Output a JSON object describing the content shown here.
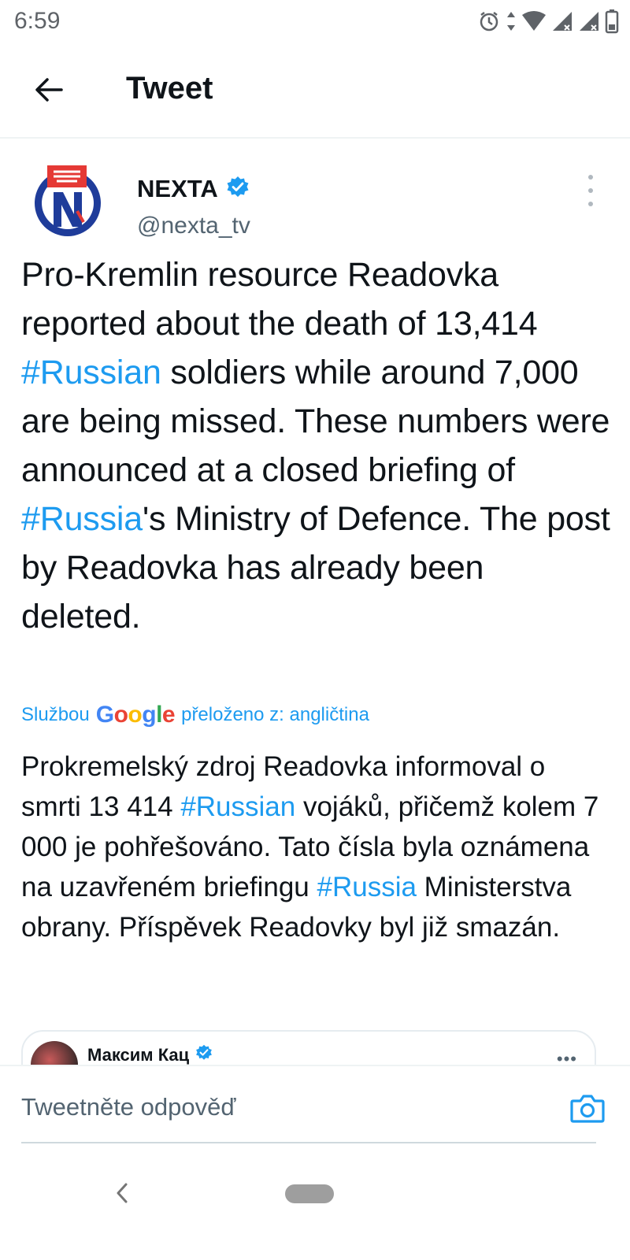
{
  "status_bar": {
    "time": "6:59",
    "icons": [
      "alarm-icon",
      "data-arrows-icon",
      "wifi-icon",
      "signal-icon",
      "signal-no-service-icon",
      "battery-icon"
    ]
  },
  "header": {
    "title": "Tweet",
    "back_icon": "back-arrow-icon"
  },
  "tweet": {
    "author_name": "NEXTA",
    "author_handle": "@nexta_tv",
    "verified": true,
    "text_parts": {
      "p1": "Pro-Kremlin resource Readovka reported about the death of 13,414 ",
      "tag1": "#Russian",
      "p2": " soldiers while around 7,000 are being missed. These numbers were announced at a closed briefing of ",
      "tag2": "#Russia",
      "p3": "'s Ministry of Defence. The post by Readovka has already been deleted."
    },
    "translation": {
      "prefix": "Službou",
      "provider": "Google",
      "suffix": "přeloženo z: angličtina",
      "text_parts": {
        "p1": "Prokremelský zdroj Readovka informoval o smrti 13 414 ",
        "tag1": "#Russian",
        "p2": " vojáků, přičemž kolem 7 000 je pohřešováno. Tato čísla byla oznámena na uzavřeném briefingu ",
        "tag2": "#Russia",
        "p3": " Ministerstva obrany. Příspěvek Readovky byl již smazán."
      }
    }
  },
  "quoted_tweet": {
    "author_name": "Максим Кац",
    "verified": true,
    "more_label": "•••"
  },
  "reply": {
    "placeholder": "Tweetněte odpověď"
  },
  "colors": {
    "link": "#1d9bf0",
    "text": "#0f1419",
    "muted": "#536471",
    "nexta_red": "#e53935",
    "nexta_blue": "#1f3c9a"
  }
}
